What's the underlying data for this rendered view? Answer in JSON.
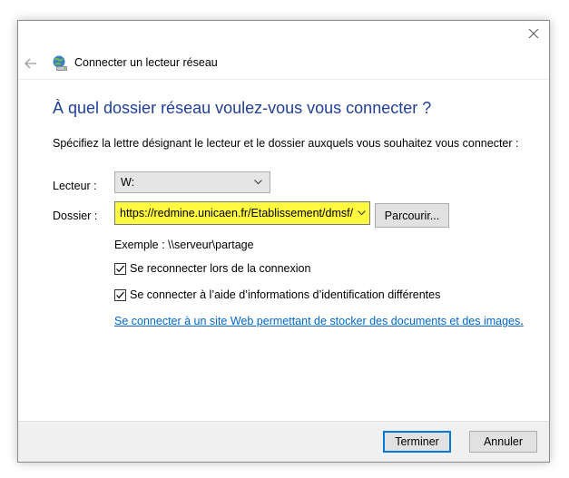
{
  "window": {
    "title": "Connecter un lecteur réseau",
    "close_glyph": "×"
  },
  "icons": {
    "back": "back-arrow-icon",
    "network_drive": "network-drive-icon",
    "close": "close-icon",
    "chevron": "chevron-down-icon",
    "check": "checkmark-icon"
  },
  "colors": {
    "heading": "#1f3f9b",
    "link": "#0066cc",
    "folder_highlight": "#fffa40",
    "default_button_border": "#0078d7"
  },
  "main": {
    "heading": "À quel dossier réseau voulez-vous vous connecter ?",
    "instructions": "Spécifiez la lettre désignant le lecteur et le dossier auxquels vous souhaitez vous connecter :",
    "drive_label": "Lecteur :",
    "drive_value": "W:",
    "folder_label": "Dossier :",
    "folder_value": "https://redmine.unicaen.fr/Etablissement/dmsf/\\",
    "browse_label": "Parcourir...",
    "example": "Exemple : \\\\serveur\\partage",
    "reconnect_label": "Se reconnecter lors de la connexion",
    "reconnect_checked": true,
    "other_credentials_label": "Se connecter à l’aide d’informations d’identification différentes",
    "other_credentials_checked": true,
    "link_text": "Se connecter à un site Web permettant de stocker des documents et des images",
    "link_trailing": "."
  },
  "footer": {
    "finish_label": "Terminer",
    "cancel_label": "Annuler"
  }
}
